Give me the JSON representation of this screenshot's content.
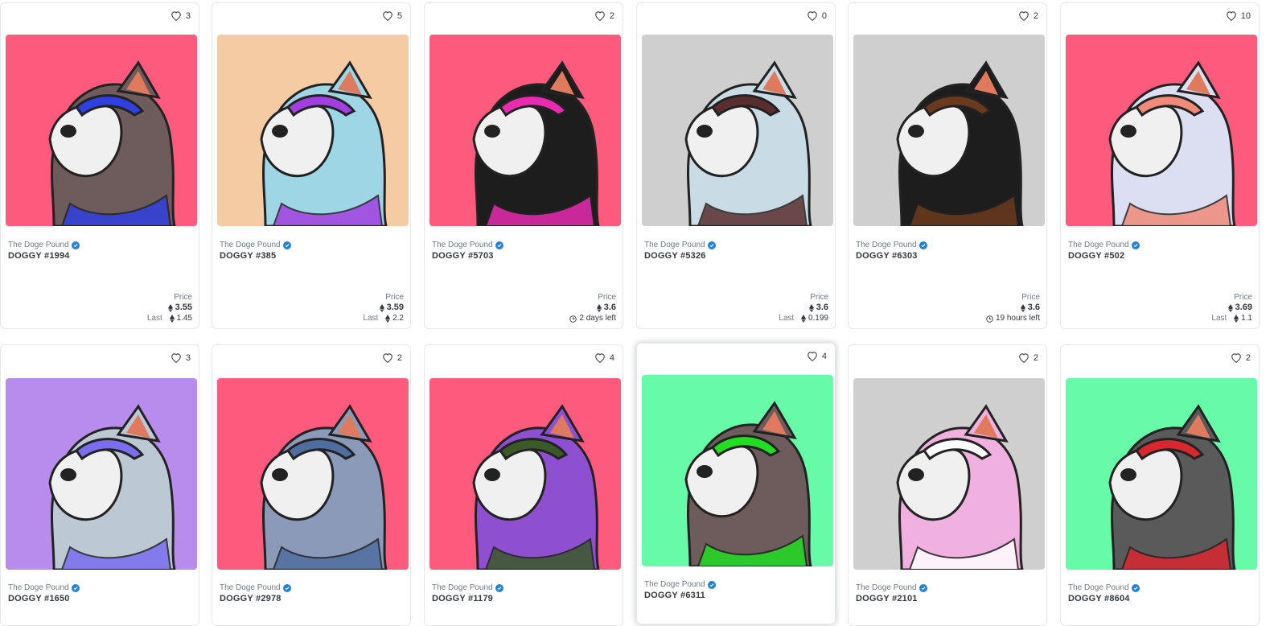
{
  "collection_name": "The Doge Pound",
  "price_label": "Price",
  "last_label": "Last",
  "cards": [
    {
      "name": "DOGGY #1994",
      "likes": "3",
      "price": "3.55",
      "last": "1.45",
      "bg": "#fe5a7e"
    },
    {
      "name": "DOGGY #385",
      "likes": "5",
      "price": "3.59",
      "last": "2.2",
      "bg": "#f5cba3"
    },
    {
      "name": "DOGGY #5703",
      "likes": "2",
      "price": "3.6",
      "time_left": "2 days left",
      "bg": "#fe5a7e"
    },
    {
      "name": "DOGGY #5326",
      "likes": "0",
      "price": "3.6",
      "last": "0.199",
      "bg": "#cfcfcf"
    },
    {
      "name": "DOGGY #6303",
      "likes": "2",
      "price": "3.6",
      "time_left": "19 hours left",
      "bg": "#cfcfcf"
    },
    {
      "name": "DOGGY #502",
      "likes": "10",
      "price": "3.69",
      "last": "1.1",
      "bg": "#fe5a7e"
    },
    {
      "name": "DOGGY #1650",
      "likes": "3",
      "bg": "#b88ced"
    },
    {
      "name": "DOGGY #2978",
      "likes": "2",
      "bg": "#fe5a7e"
    },
    {
      "name": "DOGGY #1179",
      "likes": "4",
      "bg": "#fe5a7e"
    },
    {
      "name": "DOGGY #6311",
      "likes": "4",
      "bg": "#66fba9"
    },
    {
      "name": "DOGGY #2101",
      "likes": "2",
      "bg": "#cfcfcf"
    },
    {
      "name": "DOGGY #8604",
      "likes": "2",
      "bg": "#66fba9"
    }
  ],
  "colors": {
    "verified": "#2081e2",
    "text": "#353840",
    "muted": "#707a83",
    "border": "#e5e8eb"
  }
}
